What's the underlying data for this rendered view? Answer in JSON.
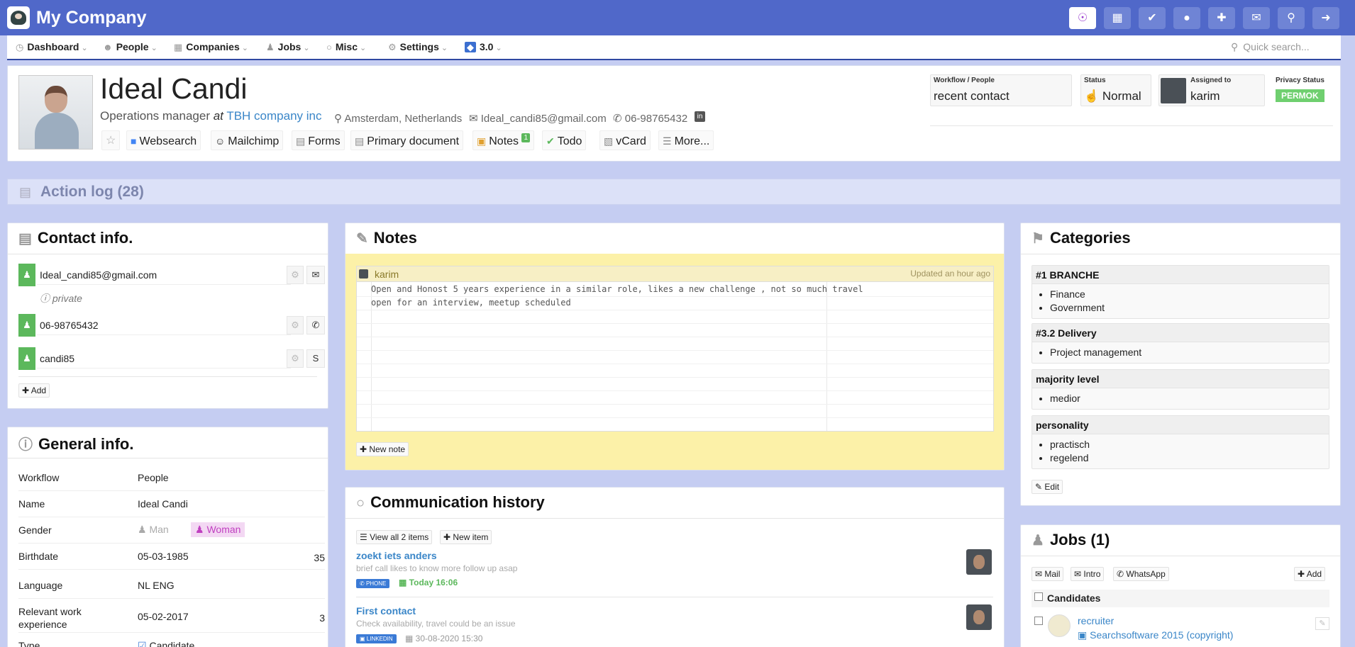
{
  "app": {
    "title": "My Company"
  },
  "nav": {
    "dashboard": "Dashboard",
    "people": "People",
    "companies": "Companies",
    "jobs": "Jobs",
    "misc": "Misc",
    "settings": "Settings",
    "version": "3.0",
    "search_placeholder": "Quick search..."
  },
  "profile": {
    "name": "Ideal Candi",
    "role": "Operations manager",
    "at": "at",
    "company": "TBH company inc",
    "location": "Amsterdam, Netherlands",
    "email": "Ideal_candi85@gmail.com",
    "phone": "06-98765432",
    "actions": {
      "websearch": "Websearch",
      "mailchimp": "Mailchimp",
      "forms": "Forms",
      "primary_document": "Primary document",
      "notes": "Notes",
      "notes_count": "1",
      "todo": "Todo",
      "vcard": "vCard",
      "more": "More..."
    },
    "workflow_label": "Workflow / People",
    "workflow_value": "recent contact",
    "status_label": "Status",
    "status_value": "Normal",
    "assigned_label": "Assigned to",
    "assigned_value": "karim",
    "privacy_label": "Privacy Status",
    "privacy_value": "PERMOK"
  },
  "action_log": {
    "title": "Action log (28)"
  },
  "contact": {
    "title": "Contact info.",
    "email": "Ideal_candi85@gmail.com",
    "private": "private",
    "phone": "06-98765432",
    "skype": "candi85",
    "add": "Add"
  },
  "general": {
    "title": "General info.",
    "rows": [
      {
        "k": "Workflow",
        "v": "People",
        "n": ""
      },
      {
        "k": "Name",
        "v": "Ideal Candi",
        "n": ""
      },
      {
        "k": "Gender",
        "v": "",
        "n": ""
      },
      {
        "k": "Birthdate",
        "v": "05-03-1985",
        "n": "35"
      },
      {
        "k": "Language",
        "v": "NL ENG",
        "n": ""
      },
      {
        "k": "Relevant work experience",
        "v": "05-02-2017",
        "n": "3"
      },
      {
        "k": "Type",
        "v": "Candidate",
        "n": ""
      }
    ],
    "gender_man": "Man",
    "gender_woman": "Woman"
  },
  "notes": {
    "title": "Notes",
    "user": "karim",
    "updated": "Updated an hour ago",
    "line1": "Open and Honost 5 years  experience in a similar role, likes a new challenge , not so much travel",
    "line2": "open for an interview, meetup scheduled",
    "new_note": "New note"
  },
  "comm": {
    "title": "Communication history",
    "view_all": "View all 2 items",
    "new_item": "New item",
    "items": [
      {
        "title": "zoekt iets anders",
        "desc": "brief call likes to know more follow up asap",
        "tag": "PHONE",
        "date": "Today 16:06"
      },
      {
        "title": "First contact",
        "desc": "Check availability, travel could be an issue",
        "tag": "LINKEDIN",
        "date": "30-08-2020 15:30"
      }
    ]
  },
  "categories": {
    "title": "Categories",
    "groups": [
      {
        "name": "#1 BRANCHE",
        "items": [
          "Finance",
          "Government"
        ]
      },
      {
        "name": "#3.2 Delivery",
        "items": [
          "Project management"
        ]
      },
      {
        "name": "majority level",
        "items": [
          "medior"
        ]
      },
      {
        "name": "personality",
        "items": [
          "practisch",
          "regelend"
        ]
      }
    ],
    "edit": "Edit"
  },
  "jobs": {
    "title": "Jobs (1)",
    "mail": "Mail",
    "intro": "Intro",
    "whatsapp": "WhatsApp",
    "add": "Add",
    "candidates": "Candidates",
    "job_title": "recruiter",
    "job_company": "Searchsoftware 2015 (copyright)"
  },
  "colors": {
    "topbar": "#5068c9",
    "accent": "#3a86c8",
    "green": "#5cb85c",
    "notes_bg": "#fcf1a8"
  }
}
